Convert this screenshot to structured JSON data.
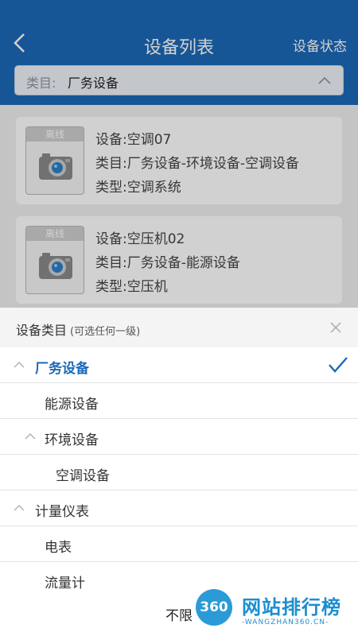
{
  "header": {
    "back_icon": "chevron-left-icon",
    "title": "设备列表",
    "status_button": "设备状态"
  },
  "filter": {
    "label": "类目:",
    "value": "厂务设备",
    "chevron_icon": "chevron-up-icon"
  },
  "devices": [
    {
      "badge": "离线",
      "device_label": "设备:",
      "device": "空调07",
      "category_label": "类目:",
      "category": "厂务设备-环境设备-空调设备",
      "type_label": "类型:",
      "type": "空调系统",
      "icon": "camera-icon"
    },
    {
      "badge": "离线",
      "device_label": "设备:",
      "device": "空压机02",
      "category_label": "类目:",
      "category": "厂务设备-能源设备",
      "type_label": "类型:",
      "type": "空压机",
      "icon": "camera-icon"
    }
  ],
  "sheet": {
    "title": "设备类目",
    "subtitle": "(可选任何一级)",
    "close_icon": "close-icon",
    "items": [
      {
        "label": "厂务设备",
        "selected": true,
        "expanded": true
      },
      {
        "label": "能源设备"
      },
      {
        "label": "环境设备",
        "expanded": true
      },
      {
        "label": "空调设备"
      },
      {
        "label": "计量仪表",
        "expanded": true
      },
      {
        "label": "电表"
      },
      {
        "label": "流量计"
      }
    ],
    "footer_button": "不限",
    "check_icon": "checkmark-icon"
  },
  "watermark": {
    "badge": "360",
    "text": "网站排行榜",
    "sub": "-WANGZHAN360.CN-"
  },
  "colors": {
    "header": "#1d6ab8",
    "accent": "#1d6ab8"
  }
}
